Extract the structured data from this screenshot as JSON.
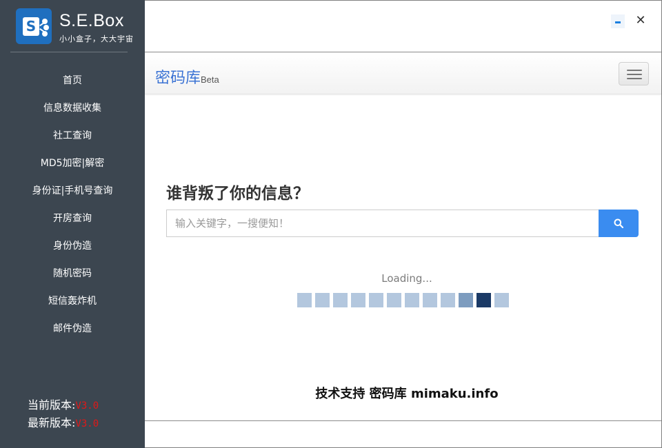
{
  "brand": {
    "title": "S.E.Box",
    "subtitle": "小小盒子，大大宇宙",
    "logo_letter": "S"
  },
  "sidebar": {
    "items": [
      {
        "label": "首页"
      },
      {
        "label": "信息数据收集"
      },
      {
        "label": "社工查询"
      },
      {
        "label": "MD5加密|解密"
      },
      {
        "label": "身份证|手机号查询"
      },
      {
        "label": "开房查询"
      },
      {
        "label": "身份伪造"
      },
      {
        "label": "随机密码"
      },
      {
        "label": "短信轰炸机"
      },
      {
        "label": "邮件伪造"
      }
    ],
    "current_version_label": "当前版本:",
    "current_version_value": "V3.0",
    "latest_version_label": "最新版本:",
    "latest_version_value": "V3.0"
  },
  "window": {
    "minimize_icon": "minimize-icon",
    "close_symbol": "✕"
  },
  "navbar": {
    "brand": "密码库",
    "badge": "Beta"
  },
  "main": {
    "headline": "谁背叛了你的信息？",
    "search_placeholder": "输入关键字，一搜便知！",
    "loading_text": "Loading...",
    "loader": {
      "squares": 12,
      "active_index": 10,
      "trail_index": 9,
      "colors": {
        "idle": "#b3c7de",
        "trail": "#7d9cbf",
        "active": "#1b3a66"
      }
    },
    "footer": "技术支持 密码库 mimaku.info"
  },
  "colors": {
    "sidebar_bg": "#3c4650",
    "accent": "#3a8cf0",
    "brand_blue": "#3b73d4",
    "version_red": "#e01818"
  }
}
